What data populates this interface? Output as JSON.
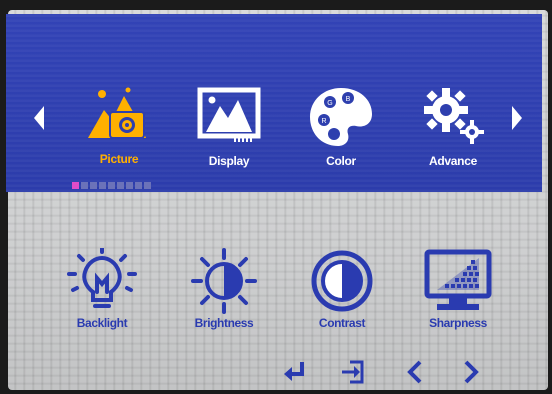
{
  "menu": {
    "tabs": [
      {
        "label": "Picture",
        "icon": "picture-icon",
        "active": true
      },
      {
        "label": "Display",
        "icon": "display-icon",
        "active": false
      },
      {
        "label": "Color",
        "icon": "color-palette-icon",
        "active": false
      },
      {
        "label": "Advance",
        "icon": "gear-icon",
        "active": false
      }
    ],
    "page_indicator": {
      "count": 9,
      "active_index": 0
    }
  },
  "submenu": {
    "items": [
      {
        "label": "Backlight",
        "icon": "lightbulb-icon"
      },
      {
        "label": "Brightness",
        "icon": "sun-icon"
      },
      {
        "label": "Contrast",
        "icon": "contrast-icon"
      },
      {
        "label": "Sharpness",
        "icon": "sharpness-icon"
      }
    ]
  },
  "navigation": {
    "buttons": [
      "enter",
      "exit",
      "previous",
      "next"
    ]
  },
  "colors": {
    "band": "#2e3fae",
    "active_label": "#ffb000",
    "submenu_icon": "#2a3bb0",
    "indicator_active": "#e14cc8"
  }
}
